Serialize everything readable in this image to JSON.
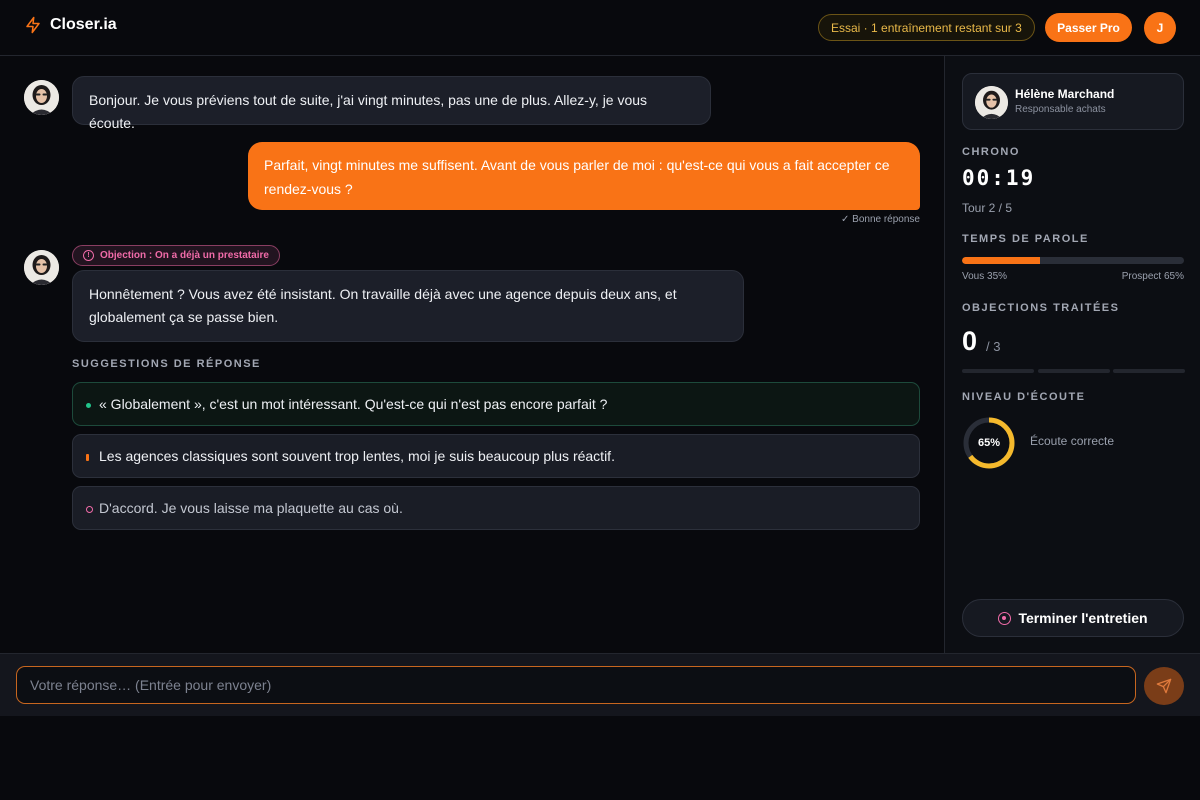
{
  "header": {
    "app_name": "Closer.ia",
    "trial_badge": "Essai · 1 entraînement restant sur 3",
    "pro_button": "Passer Pro",
    "user_initial": "J",
    "accent_color": "#f97316"
  },
  "chat": {
    "messages": [
      {
        "role": "prospect",
        "text": "Bonjour. Je vous préviens tout de suite, j'ai vingt minutes, pas une de plus. Allez-y, je vous écoute."
      },
      {
        "role": "user",
        "text": "Parfait, vingt minutes me suffisent. Avant de vous parler de moi : qu'est-ce qui vous a fait accepter ce rendez-vous ?",
        "feedback": "✓ Bonne réponse"
      },
      {
        "role": "prospect",
        "objection_tag": "Objection : On a déjà un prestataire",
        "text": "Honnêtement ? Vous avez été insistant. On travaille déjà avec une agence depuis deux ans, et globalement ça se passe bien."
      }
    ],
    "suggestions_title": "SUGGESTIONS DE RÉPONSE",
    "suggestions": [
      {
        "text": "« Globalement », c'est un mot intéressant. Qu'est-ce qui n'est pas encore parfait ?",
        "quality": "good",
        "color": "#22c58b"
      },
      {
        "text": "Les agences classiques sont souvent trop lentes, moi je suis beaucoup plus réactif.",
        "quality": "average",
        "color": "#f97316"
      },
      {
        "text": "D'accord. Je vous laisse ma plaquette au cas où.",
        "quality": "bad",
        "color": "#f06ba8"
      }
    ]
  },
  "sidebar": {
    "prospect_name": "Hélène Marchand",
    "prospect_role": "Responsable achats",
    "chrono_label": "CHRONO",
    "chrono_value": "00:19",
    "round_text": "Tour 2 / 5",
    "talk_label": "TEMPS DE PAROLE",
    "talk_you": "Vous 35%",
    "talk_prospect": "Prospect 65%",
    "talk_you_fraction": 0.35,
    "objections_label": "OBJECTIONS TRAITÉES",
    "objections_count": "0",
    "objections_total": "/ 3",
    "listening_label": "NIVEAU D'ÉCOUTE",
    "listening_value": "65%",
    "listening_fraction": 0.65,
    "listening_text": "Écoute correcte",
    "end_button": "Terminer l'entretien"
  },
  "input": {
    "placeholder": "Votre réponse… (Entrée pour envoyer)"
  }
}
